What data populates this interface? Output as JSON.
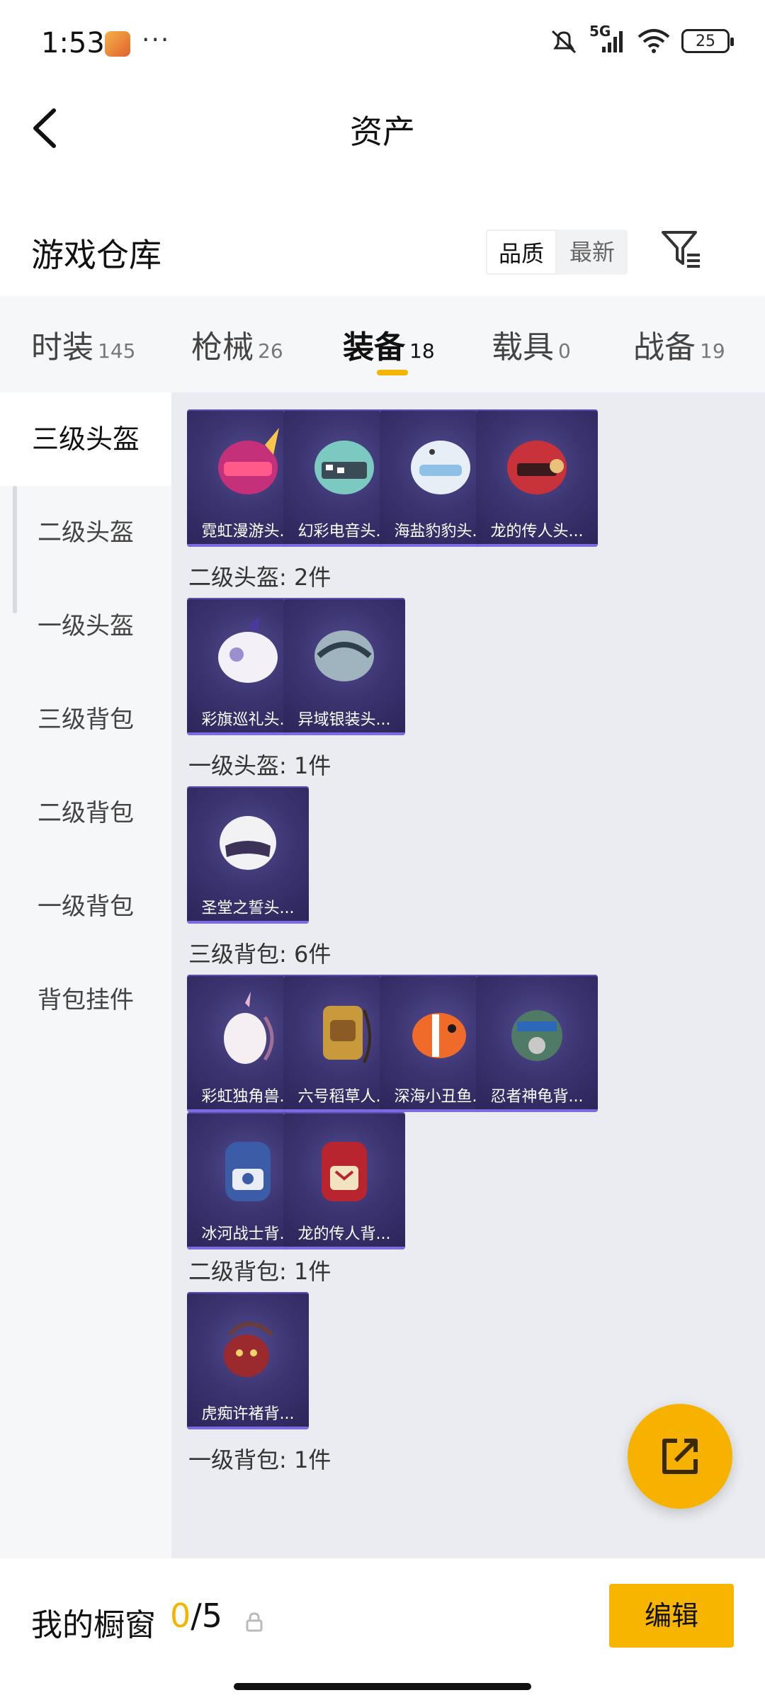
{
  "status": {
    "time": "1:53",
    "dots": "···",
    "network": "5G",
    "battery": "25"
  },
  "nav": {
    "title": "资产",
    "back_icon": "chevron-left-icon"
  },
  "warehouse": {
    "title": "游戏仓库",
    "sort": [
      "品质",
      "最新"
    ],
    "sort_selected": "品质",
    "filter_icon": "filter-icon"
  },
  "tabs": [
    {
      "label": "时装",
      "count": "145"
    },
    {
      "label": "枪械",
      "count": "26"
    },
    {
      "label": "装备",
      "count": "18"
    },
    {
      "label": "载具",
      "count": "0"
    },
    {
      "label": "战备",
      "count": "19"
    }
  ],
  "active_tab": "装备",
  "sidebar": [
    "三级头盔",
    "二级头盔",
    "一级头盔",
    "三级背包",
    "二级背包",
    "一级背包",
    "背包挂件"
  ],
  "sidebar_active": "三级头盔",
  "sections": [
    {
      "label": "",
      "items": [
        "霓虹漫游头...",
        "幻彩电音头...",
        "海盐豹豹头...",
        "龙的传人头..."
      ]
    },
    {
      "label": "二级头盔: 2件",
      "items": [
        "彩旗巡礼头...",
        "异域银装头..."
      ]
    },
    {
      "label": "一级头盔: 1件",
      "items": [
        "圣堂之誓头..."
      ]
    },
    {
      "label": "三级背包: 6件",
      "items": [
        "彩虹独角兽...",
        "六号稻草人...",
        "深海小丑鱼...",
        "忍者神龟背...",
        "冰河战士背...",
        "龙的传人背..."
      ]
    },
    {
      "label": "二级背包: 1件",
      "items": [
        "虎痴许褚背..."
      ]
    },
    {
      "label": "一级背包: 1件",
      "items": []
    }
  ],
  "bottom": {
    "showcase_label": "我的橱窗",
    "current": "0",
    "total": "/5",
    "edit": "编辑"
  },
  "colors": {
    "accent": "#f5b400",
    "card_bg": "#3b3471",
    "card_border": "#7d6ae0"
  }
}
